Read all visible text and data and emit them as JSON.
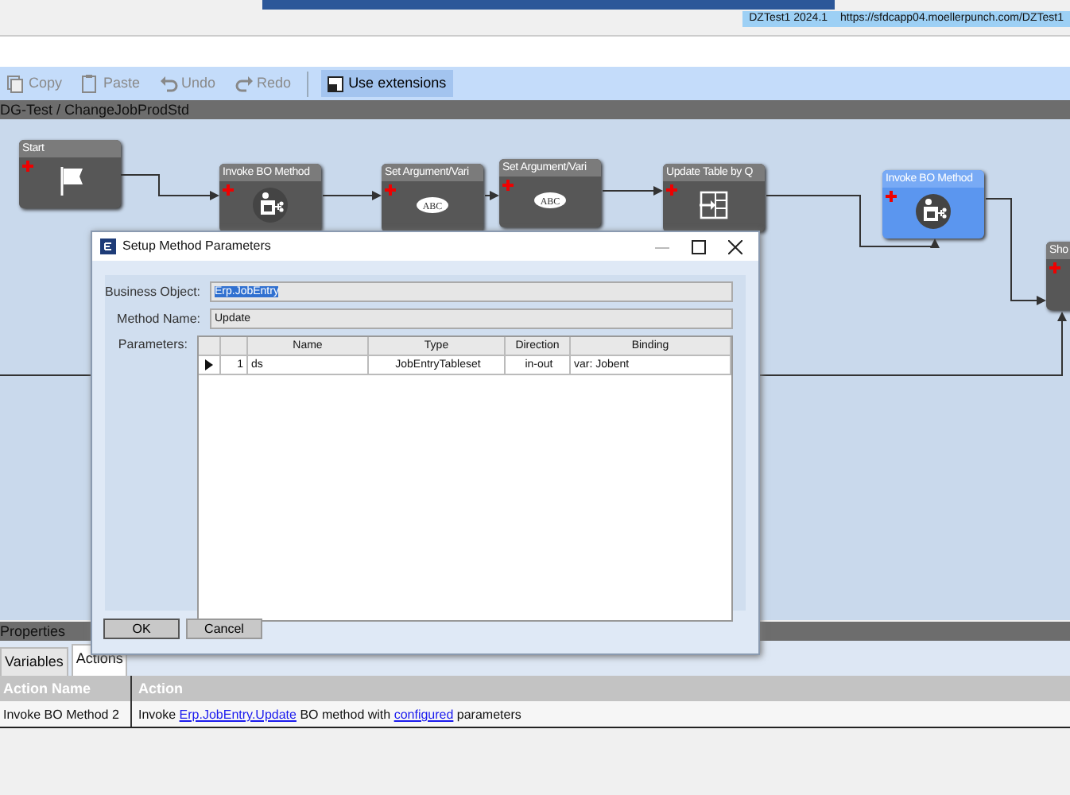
{
  "title_bar": {
    "environment": "DZTest1 2024.1",
    "url": "https://sfdcapp04.moellerpunch.com/DZTest1"
  },
  "toolbar": [
    {
      "label": "Copy",
      "kind": "copy",
      "disabled": true
    },
    {
      "label": "Paste",
      "kind": "paste",
      "disabled": true
    },
    {
      "label": "Undo",
      "kind": "undo",
      "disabled": true
    },
    {
      "label": "Redo",
      "kind": "redo",
      "disabled": true
    }
  ],
  "extensions_toggle": {
    "label": "Use extensions",
    "on": true
  },
  "breadcrumb": "DG-Test / ChangeJobProdStd",
  "workflow": {
    "nodes": [
      {
        "title": "Start",
        "kind": "start",
        "selected": false
      },
      {
        "title": "Invoke BO Method",
        "kind": "invoke",
        "selected": false
      },
      {
        "title": "Set Argument/Vari",
        "kind": "set",
        "selected": false,
        "icon_text": "ABC"
      },
      {
        "title": "Set Argument/Vari",
        "kind": "set",
        "selected": false,
        "icon_text": "ABC"
      },
      {
        "title": "Update Table by Q",
        "kind": "update",
        "selected": false
      },
      {
        "title": "Invoke BO Method",
        "kind": "invoke",
        "selected": true
      },
      {
        "title": "Sho",
        "kind": "other",
        "selected": false
      }
    ]
  },
  "dialog": {
    "title": "Setup Method Parameters",
    "fields": [
      {
        "label": "Business Object:",
        "value": "Erp.JobEntry",
        "highlighted": true
      },
      {
        "label": "Method Name:",
        "value": "Update",
        "highlighted": false
      }
    ],
    "parameters_label": "Parameters:",
    "grid": {
      "columns": [
        "Name",
        "Type",
        "Direction",
        "Binding"
      ],
      "rows": [
        {
          "current": true,
          "number": "1",
          "cells": [
            "ds",
            "JobEntryTableset",
            "in-out",
            "var: Jobent"
          ]
        }
      ]
    },
    "buttons": [
      "OK",
      "Cancel"
    ]
  },
  "properties": {
    "title": "Properties",
    "tabs": [
      {
        "label": "Variables",
        "selected": false
      },
      {
        "label": "Actions",
        "selected": true
      }
    ],
    "table": {
      "columns": [
        "Action Name",
        "Action"
      ],
      "rows": [
        {
          "action_name": "Invoke BO Method 2",
          "action": [
            {
              "text": "Invoke ",
              "link": false
            },
            {
              "text": "Erp.JobEntry.Update",
              "link": true
            },
            {
              "text": " BO method with ",
              "link": false
            },
            {
              "text": "configured",
              "link": true
            },
            {
              "text": " parameters",
              "link": false
            }
          ]
        }
      ]
    }
  }
}
